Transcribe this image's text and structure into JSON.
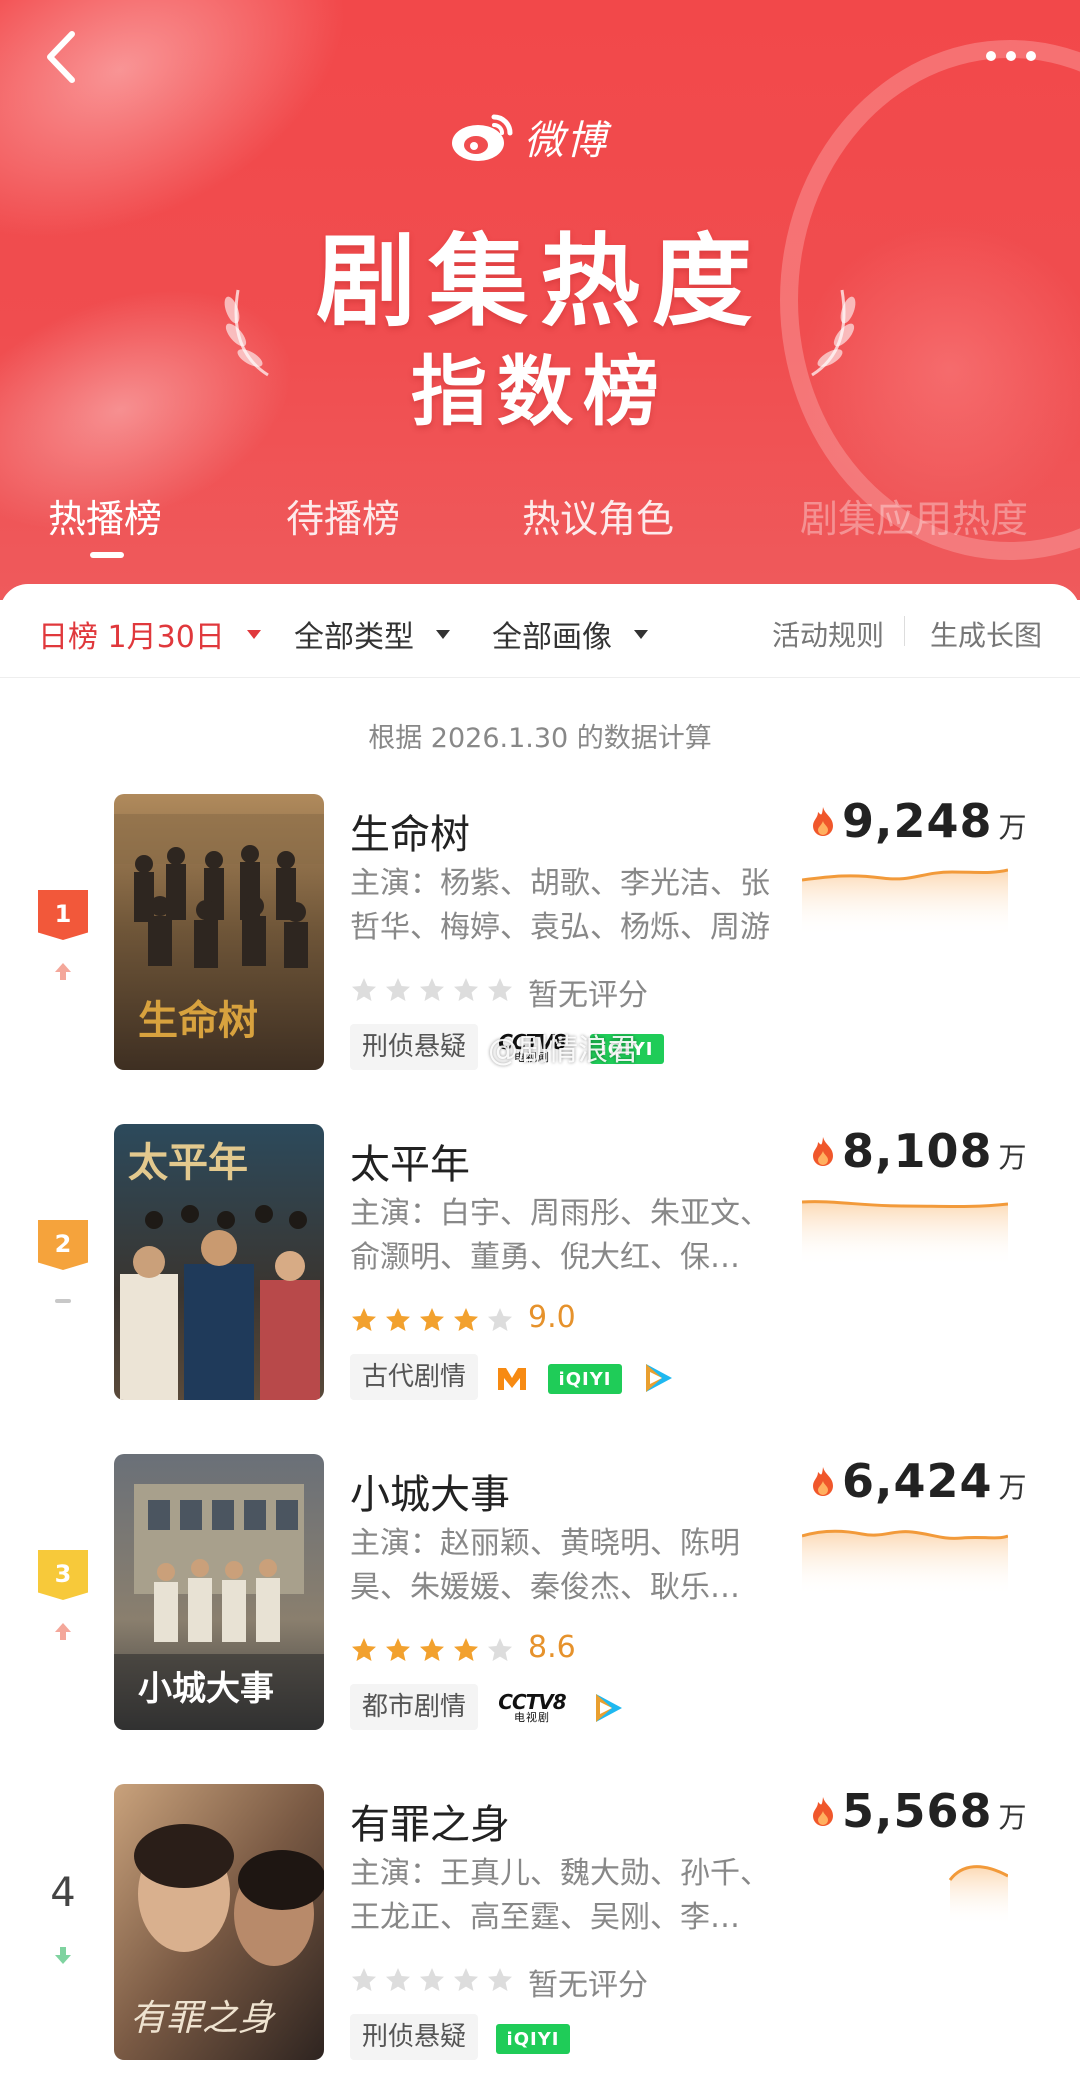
{
  "header": {
    "back_icon": "chevron-left-icon",
    "more_icon": "more-dots-icon",
    "brand_name": "微博",
    "title": "剧集热度",
    "subtitle": "指数榜",
    "colors": {
      "hero": "#f2484a",
      "accent": "#e0383c",
      "heat_line": "#f29a3a"
    }
  },
  "tabs": [
    {
      "label": "热播榜",
      "active": true
    },
    {
      "label": "待播榜",
      "active": false
    },
    {
      "label": "热议角色",
      "active": false
    },
    {
      "label": "剧集应用热度",
      "active": false
    }
  ],
  "filters": {
    "date_label": "日榜 1月30日",
    "type_label": "全部类型",
    "image_label": "全部画像",
    "rules_link": "活动规则",
    "generate_link": "生成长图"
  },
  "basis_text": "根据 2026.1.30 的数据计算",
  "watermark": "@剧情浪君",
  "items": [
    {
      "rank": "1",
      "trend": "up",
      "title": "生命树",
      "cast": "主演：杨紫、胡歌、李光洁、张哲华、梅婷、袁弘、杨烁、周游",
      "stars_filled": 0,
      "rating_text": "暂无评分",
      "genre": "刑侦悬疑",
      "platforms": [
        "CCTV8",
        "iQIYI"
      ],
      "heat_value": "9,248",
      "heat_unit": "万",
      "poster_text": "生命树"
    },
    {
      "rank": "2",
      "trend": "flat",
      "title": "太平年",
      "cast": "主演：白宇、周雨彤、朱亚文、俞灏明、董勇、倪大红、保…",
      "stars_filled": 4,
      "rating_text": "9.0",
      "genre": "古代剧情",
      "platforms": [
        "Mango",
        "iQIYI",
        "Tencent"
      ],
      "heat_value": "8,108",
      "heat_unit": "万",
      "poster_text": "太平年"
    },
    {
      "rank": "3",
      "trend": "up",
      "title": "小城大事",
      "cast": "主演：赵丽颖、黄晓明、陈明昊、朱媛媛、秦俊杰、耿乐…",
      "stars_filled": 4,
      "rating_text": "8.6",
      "genre": "都市剧情",
      "platforms": [
        "CCTV8",
        "Tencent"
      ],
      "heat_value": "6,424",
      "heat_unit": "万",
      "poster_text": "小城大事"
    },
    {
      "rank": "4",
      "trend": "down",
      "title": "有罪之身",
      "cast": "主演：王真儿、魏大勋、孙千、王龙正、高至霆、吴刚、李…",
      "stars_filled": 0,
      "rating_text": "暂无评分",
      "genre": "刑侦悬疑",
      "platforms": [
        "iQIYI"
      ],
      "heat_value": "5,568",
      "heat_unit": "万",
      "poster_text": "有罪之身"
    }
  ],
  "platform_logos": {
    "cctv_big": "CCTV8",
    "cctv_small": "电视剧",
    "iqiyi": "iQIYI"
  }
}
